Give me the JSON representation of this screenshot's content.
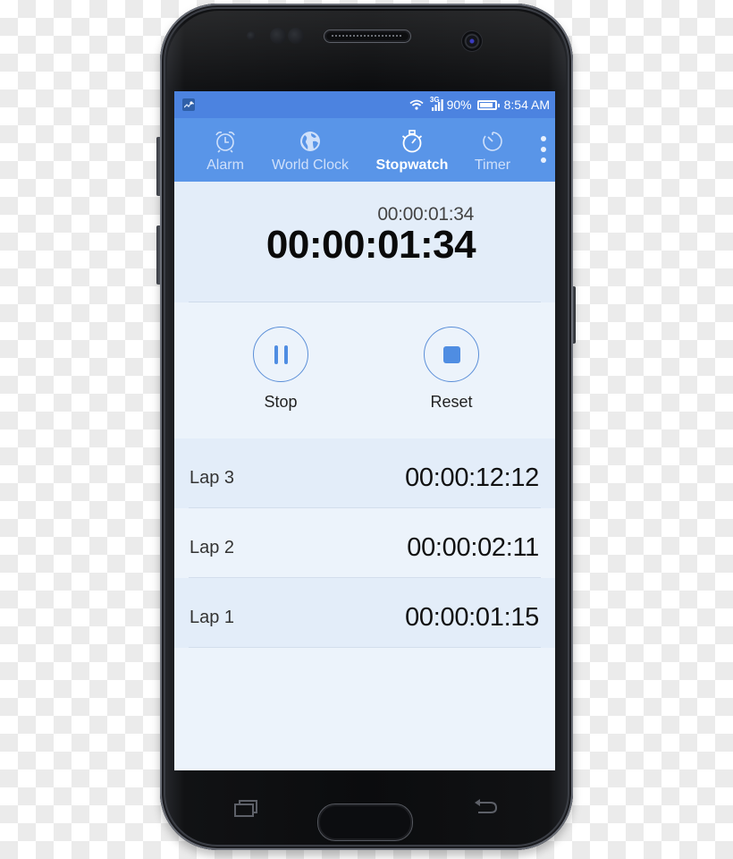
{
  "status_bar": {
    "network_type": "3G",
    "battery_percent_label": "90%",
    "battery_level": 0.9,
    "time": "8:54 AM",
    "icons": [
      "app-notification-icon",
      "wifi-icon",
      "signal-icon",
      "battery-icon"
    ]
  },
  "tabs": [
    {
      "label": "Alarm",
      "icon": "alarm-clock-icon",
      "active": false
    },
    {
      "label": "World Clock",
      "icon": "globe-icon",
      "active": false
    },
    {
      "label": "Stopwatch",
      "icon": "stopwatch-icon",
      "active": true
    },
    {
      "label": "Timer",
      "icon": "timer-icon",
      "active": false
    }
  ],
  "stopwatch": {
    "lap_elapsed": "00:00:01:34",
    "total_elapsed": "00:00:01:34"
  },
  "controls": {
    "stop_label": "Stop",
    "reset_label": "Reset"
  },
  "laps": [
    {
      "label": "Lap 3",
      "time": "00:00:12:12"
    },
    {
      "label": "Lap 2",
      "time": "00:00:02:11"
    },
    {
      "label": "Lap 1",
      "time": "00:00:01:15"
    }
  ],
  "colors": {
    "accent": "#4f8de2",
    "status_bar": "#4c83e0",
    "tab_bar": "#5995e8",
    "background": "#ecf3fb"
  }
}
